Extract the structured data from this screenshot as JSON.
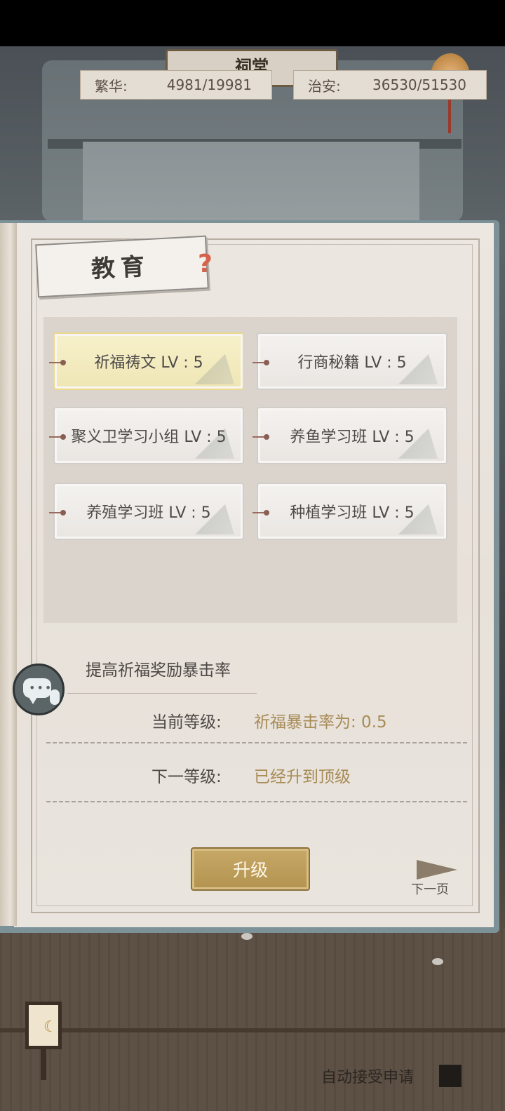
{
  "background": {
    "plaque_text": "祠堂"
  },
  "stats": {
    "prosperity": {
      "label": "繁华:",
      "value": "4981/19981"
    },
    "security": {
      "label": "治安:",
      "value": "36530/51530"
    }
  },
  "panel": {
    "title": "教育",
    "help_icon": "question-mark-icon",
    "skills": [
      {
        "label": "祈福祷文 LV : 5",
        "selected": true
      },
      {
        "label": "行商秘籍 LV : 5",
        "selected": false
      },
      {
        "label": "聚义卫学习小组 LV : 5",
        "selected": false
      },
      {
        "label": "养鱼学习班 LV : 5",
        "selected": false
      },
      {
        "label": "养殖学习班 LV : 5",
        "selected": false
      },
      {
        "label": "种植学习班 LV : 5",
        "selected": false
      }
    ],
    "description": "提高祈福奖励暴击率",
    "current_level": {
      "label": "当前等级:",
      "value": "祈福暴击率为: 0.5"
    },
    "next_level": {
      "label": "下一等级:",
      "value": "已经升到顶级"
    },
    "upgrade_label": "升级",
    "next_page_label": "下一页"
  },
  "chat_icon": "chat-bubble-icon",
  "bottom": {
    "auto_accept_label": "自动接受申请",
    "auto_accept_checked": false
  },
  "colors": {
    "accent_gold": "#b3934f",
    "value_gold": "#a88b56",
    "selected_yellow": "#efe6b4"
  }
}
